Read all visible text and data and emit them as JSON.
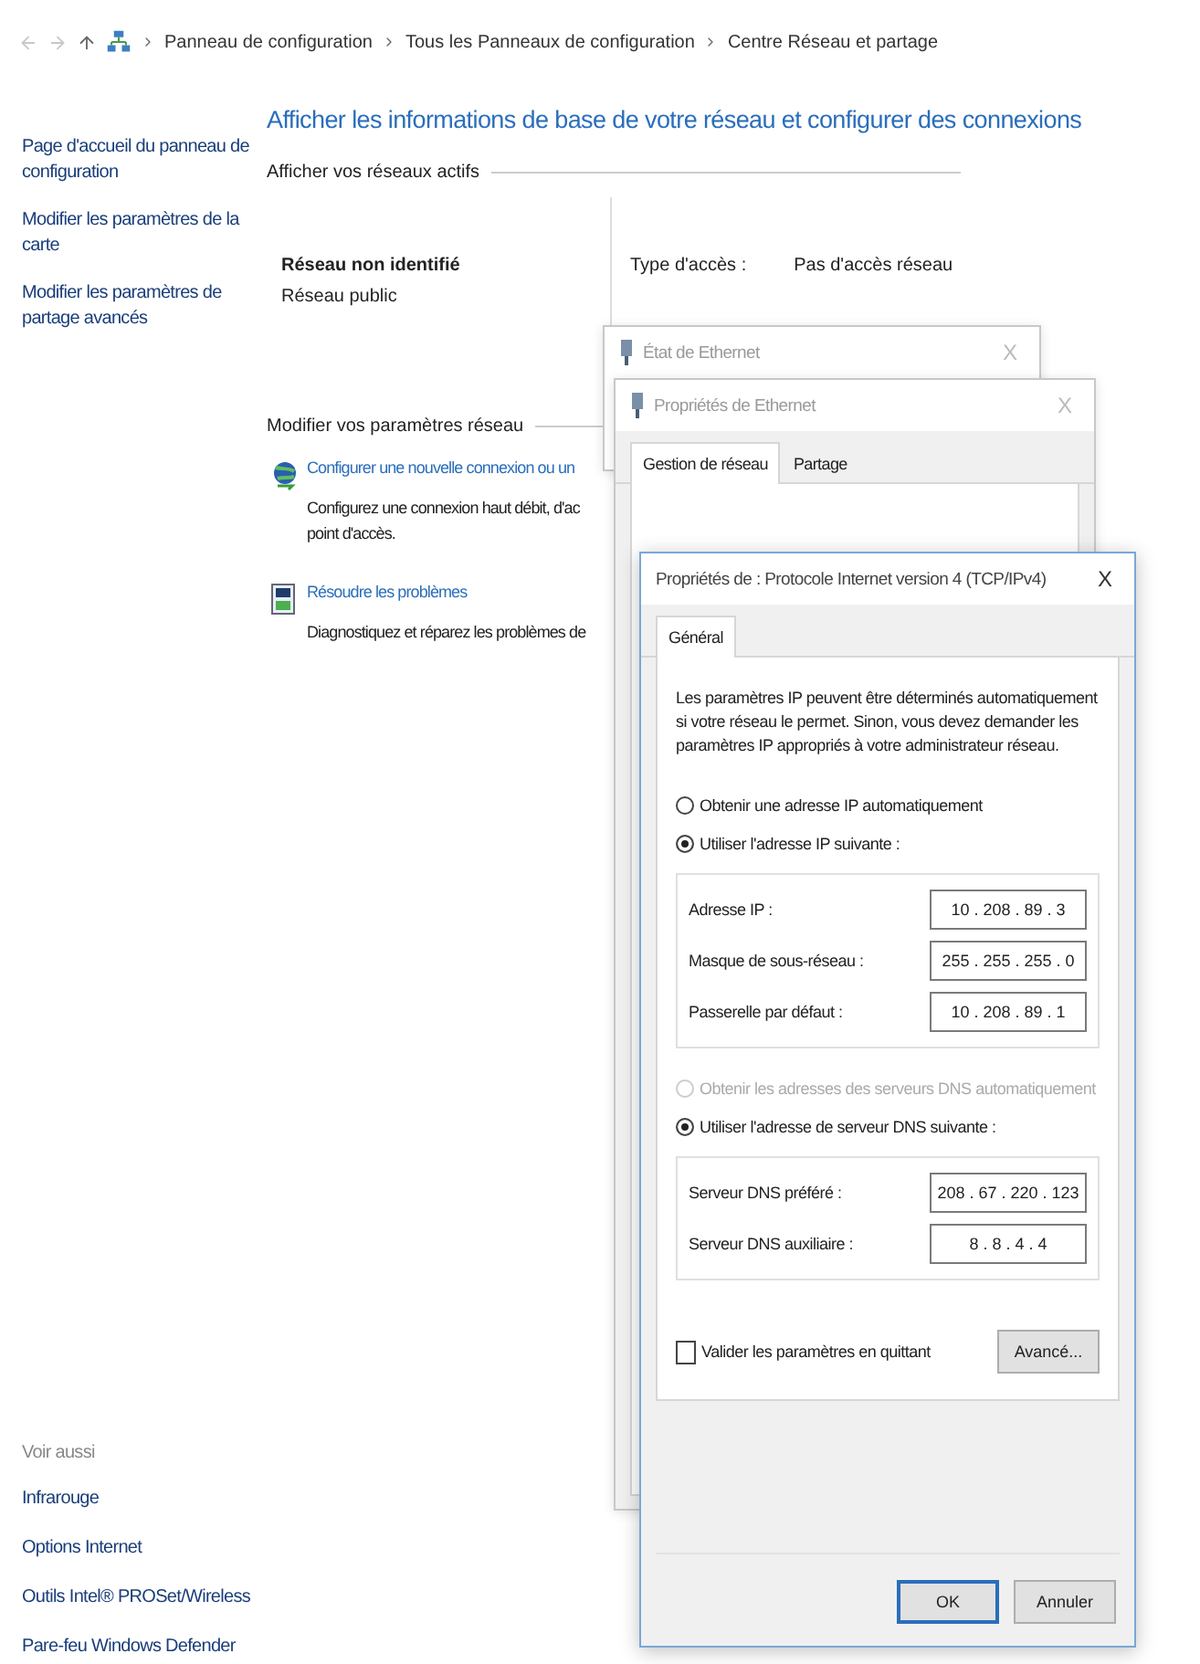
{
  "breadcrumb": {
    "items": [
      "Panneau de configuration",
      "Tous les Panneaux de configuration",
      "Centre Réseau et partage"
    ]
  },
  "sidebar": {
    "links": [
      "Page d'accueil du panneau de configuration",
      "Modifier les paramètres de la carte",
      "Modifier les paramètres de partage avancés"
    ],
    "see_also": {
      "title": "Voir aussi",
      "links": [
        "Infrarouge",
        "Options Internet",
        "Outils Intel® PROSet/Wireless",
        "Pare-feu Windows Defender"
      ]
    }
  },
  "main": {
    "title": "Afficher les informations de base de votre réseau et configurer des connexions",
    "active_networks": {
      "heading": "Afficher vos réseaux actifs",
      "network_name": "Réseau non identifié",
      "network_type": "Réseau public",
      "access_label": "Type d'accès :",
      "access_value": "Pas d'accès réseau"
    },
    "change_settings": {
      "heading": "Modifier vos paramètres réseau",
      "tasks": [
        {
          "kind": "connection",
          "link": "Configurer une nouvelle connexion ou un",
          "description_lines": [
            "Configurez une connexion haut débit, d'ac",
            "point d'accès."
          ]
        },
        {
          "kind": "troubleshoot",
          "link": "Résoudre les problèmes",
          "description_lines": [
            "Diagnostiquez et réparez les problèmes de"
          ]
        }
      ]
    }
  },
  "status_window": {
    "title": "État de Ethernet",
    "close": "X"
  },
  "properties_window": {
    "title": "Propriétés de Ethernet",
    "close": "X",
    "tabs": [
      {
        "label": "Gestion de réseau",
        "selected": true
      },
      {
        "label": "Partage",
        "selected": false
      }
    ]
  },
  "ipv4_dialog": {
    "title": "Propriétés de : Protocole Internet version 4 (TCP/IPv4)",
    "close": "X",
    "tabs": [
      {
        "label": "Général",
        "selected": true
      }
    ],
    "description": "Les paramètres IP peuvent être déterminés automatiquement si votre réseau le permet. Sinon, vous devez demander les paramètres IP appropriés à votre administrateur réseau.",
    "ip_options": [
      {
        "label": "Obtenir une adresse IP automatiquement",
        "selected": false,
        "disabled": false
      },
      {
        "label": "Utiliser l'adresse IP suivante :",
        "selected": true,
        "disabled": false
      }
    ],
    "ip_fields": [
      {
        "label": "Adresse IP :",
        "value": "10 . 208 . 89 . 3"
      },
      {
        "label": "Masque de sous-réseau :",
        "value": "255 . 255 . 255 . 0"
      },
      {
        "label": "Passerelle par défaut :",
        "value": "10 . 208 . 89 . 1"
      }
    ],
    "dns_options": [
      {
        "label": "Obtenir les adresses des serveurs DNS automatiquement",
        "selected": false,
        "disabled": true
      },
      {
        "label": "Utiliser l'adresse de serveur DNS suivante :",
        "selected": true,
        "disabled": false
      }
    ],
    "dns_fields": [
      {
        "label": "Serveur DNS préféré :",
        "value": "208 . 67 . 220 . 123"
      },
      {
        "label": "Serveur DNS auxiliaire :",
        "value": "8 . 8 . 4 . 4"
      }
    ],
    "validate": {
      "label": "Valider les paramètres en quittant",
      "checked": false
    },
    "advanced_button": "Avancé...",
    "buttons": [
      "OK",
      "Annuler"
    ]
  }
}
